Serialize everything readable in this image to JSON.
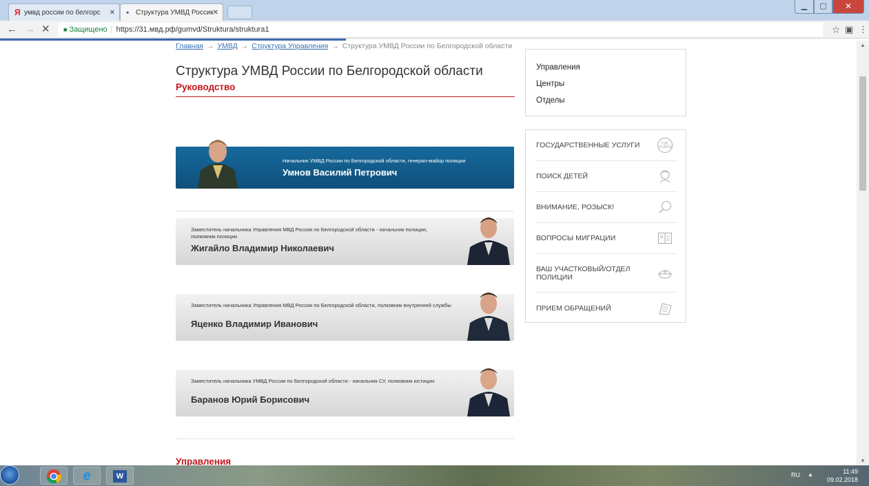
{
  "browser": {
    "tabs": [
      {
        "label": "умвд россии по белгорс",
        "icon": "Я"
      },
      {
        "label": "Структура УМВД Россик",
        "icon": "•"
      }
    ],
    "address": {
      "secure_label": "Защищено",
      "url": "https://31.мвд.рф/gumvd/Struktura/struktura1"
    }
  },
  "breadcrumb": {
    "items": [
      "Главная",
      "УМВД",
      "Структура Управления"
    ],
    "current": "Структура УМВД России по Белгородской области",
    "separator": "→"
  },
  "page": {
    "title": "Структура УМВД России по Белгородской области",
    "section": "Руководство",
    "bottom_section": "Управления"
  },
  "leaders": [
    {
      "position": "Начальник УМВД России по Белгородской области, генерал-майор полиции",
      "name": "Умнов Василий Петрович"
    },
    {
      "position": "Заместитель начальника Управления МВД России по Белгородской области - начальник полиции, полковник полиции",
      "name": "Жигайло Владимир Николаевич"
    },
    {
      "position": "Заместитель начальника Управления МВД России по Белгородской области, полковник внутренней службы",
      "name": "Яценко Владимир Иванович"
    },
    {
      "position": "Заместитель начальника УМВД России по Белгородской области - начальник СУ, полковник юстиции",
      "name": "Баранов Юрий Борисович"
    }
  ],
  "side_menu": [
    "Управления",
    "Центры",
    "Отделы"
  ],
  "services": [
    {
      "label": "Государственные услуги",
      "icon": "gosuslugi-icon",
      "icon_text": "гос услуги"
    },
    {
      "label": "Поиск детей",
      "icon": "child-search-icon"
    },
    {
      "label": "Внимание, розыск!",
      "icon": "magnifier-icon"
    },
    {
      "label": "Вопросы миграции",
      "icon": "passport-icon"
    },
    {
      "label": "Ваш участковый/отдел полиции",
      "icon": "police-cap-icon"
    },
    {
      "label": "Прием обращений",
      "icon": "documents-icon"
    }
  ],
  "taskbar": {
    "lang": "RU",
    "time": "11:49",
    "date": "09.02.2018"
  },
  "colors": {
    "accent": "#c0151c",
    "chief_card": "#135e8f",
    "link": "#3a6fb0"
  }
}
